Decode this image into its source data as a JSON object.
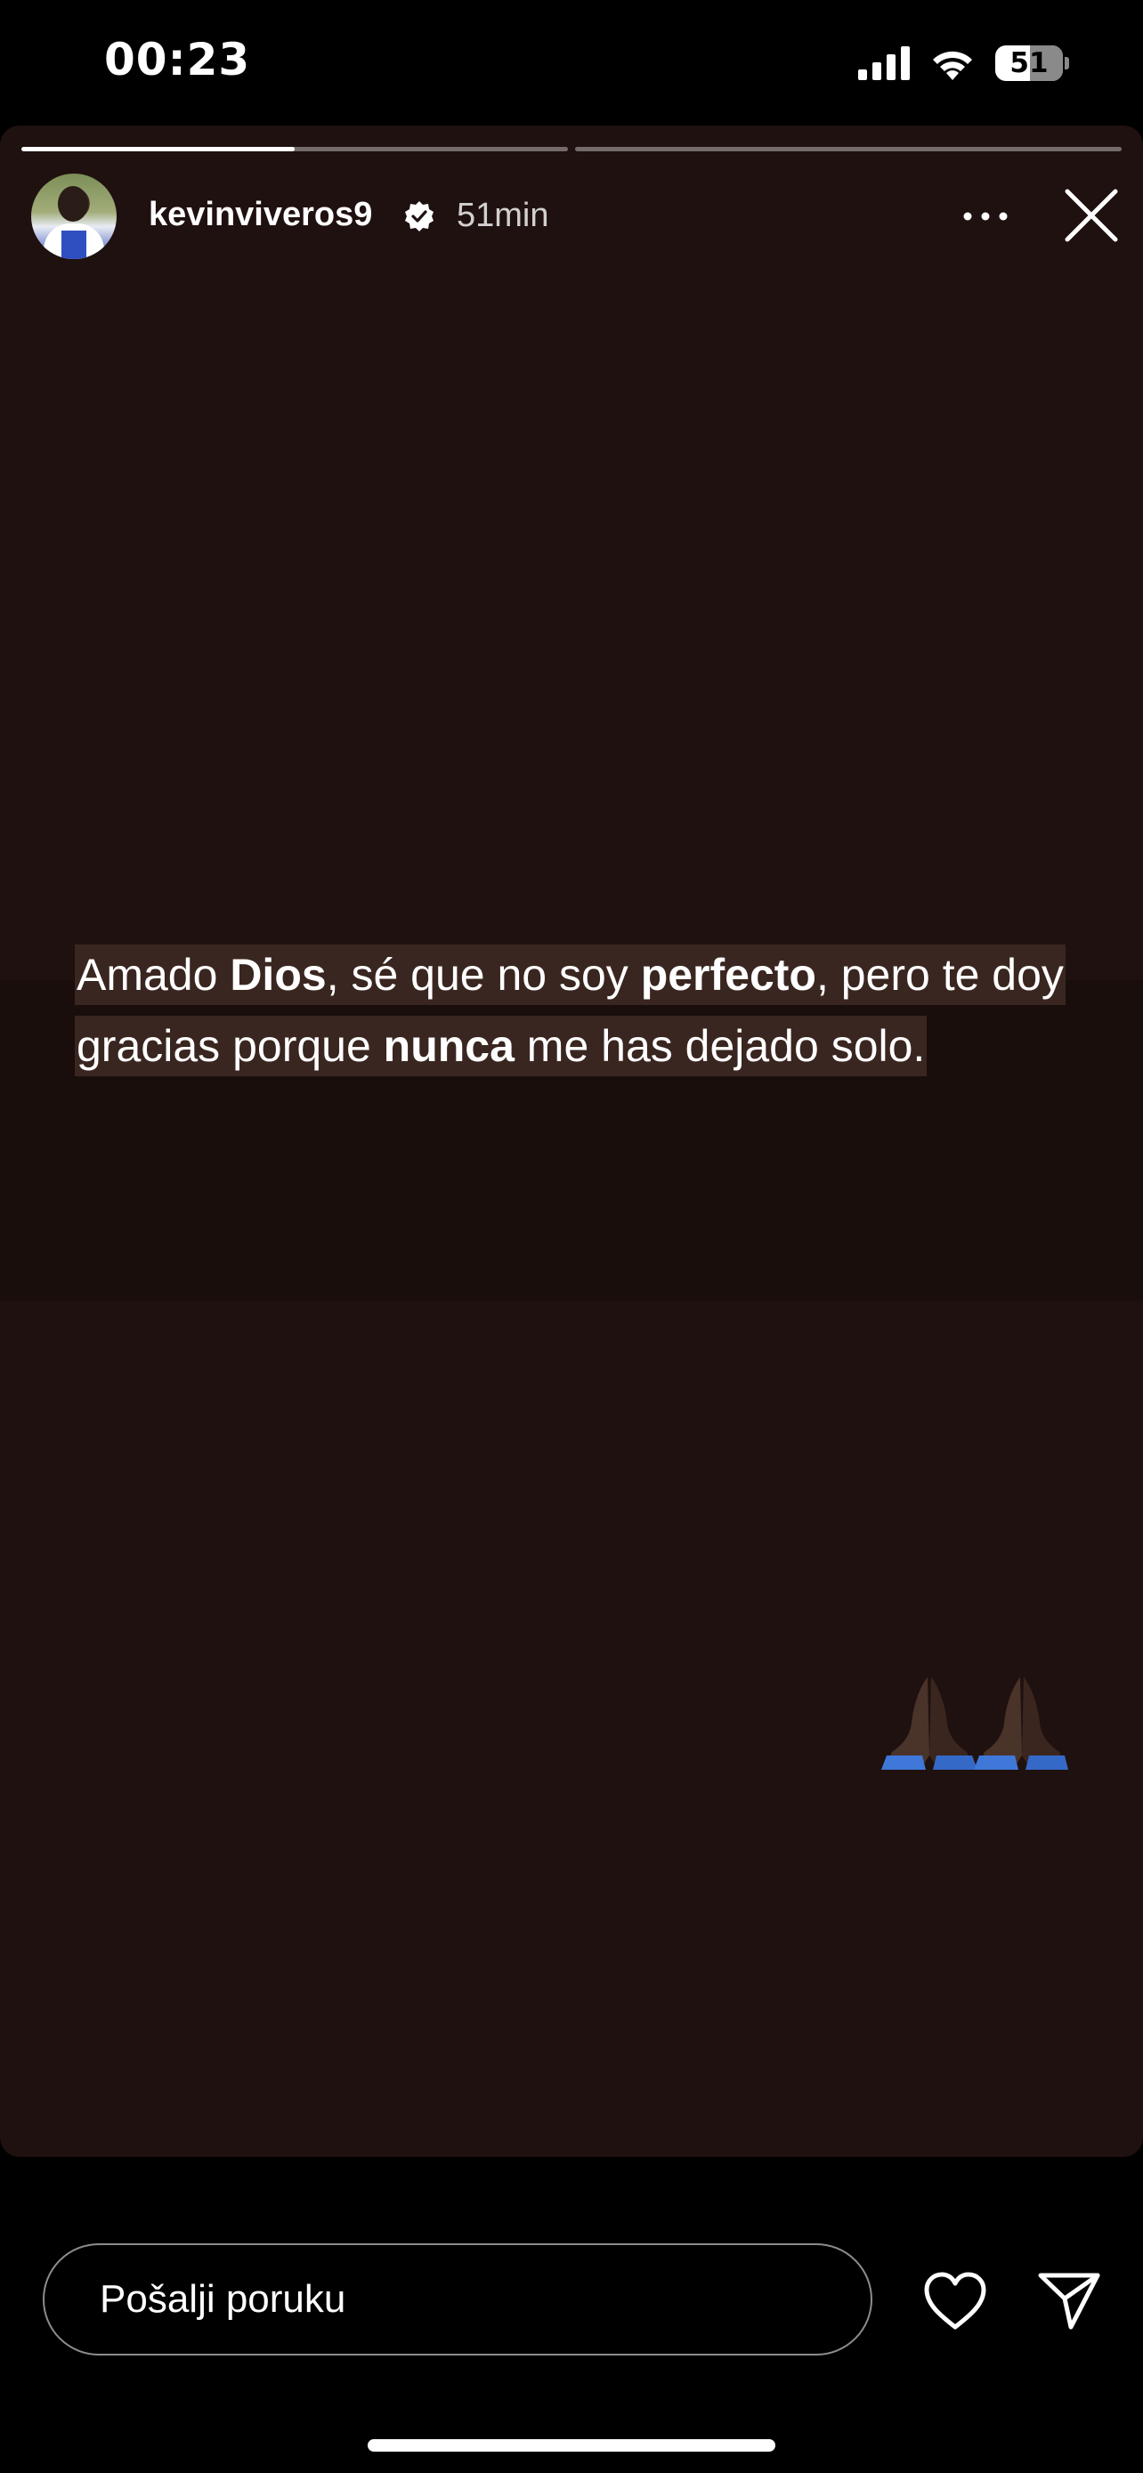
{
  "status_bar": {
    "time": "00:23",
    "battery": "51",
    "icons": [
      "signal-icon",
      "wifi-icon",
      "battery-icon"
    ]
  },
  "story": {
    "progress": {
      "segments": 2,
      "active_index": 0,
      "active_fraction": 0.5
    },
    "username": "kevinviveros9",
    "verified": true,
    "time_ago": "51min",
    "caption": {
      "parts": [
        {
          "text": "Amado ",
          "bold": false
        },
        {
          "text": "Dios",
          "bold": true
        },
        {
          "text": ", sé que no soy ",
          "bold": false
        },
        {
          "text": "perfecto",
          "bold": true
        },
        {
          "text": ", pero te doy gracias porque ",
          "bold": false
        },
        {
          "text": "nunca",
          "bold": true
        },
        {
          "text": " me has dejado solo.",
          "bold": false
        }
      ]
    },
    "sticker": "praying-hands-emoji"
  },
  "reply": {
    "placeholder": "Pošalji poruku"
  },
  "colors": {
    "story_background": "#1f1110",
    "text_band": "#190e0c",
    "caption_highlight": "#3a2620"
  }
}
